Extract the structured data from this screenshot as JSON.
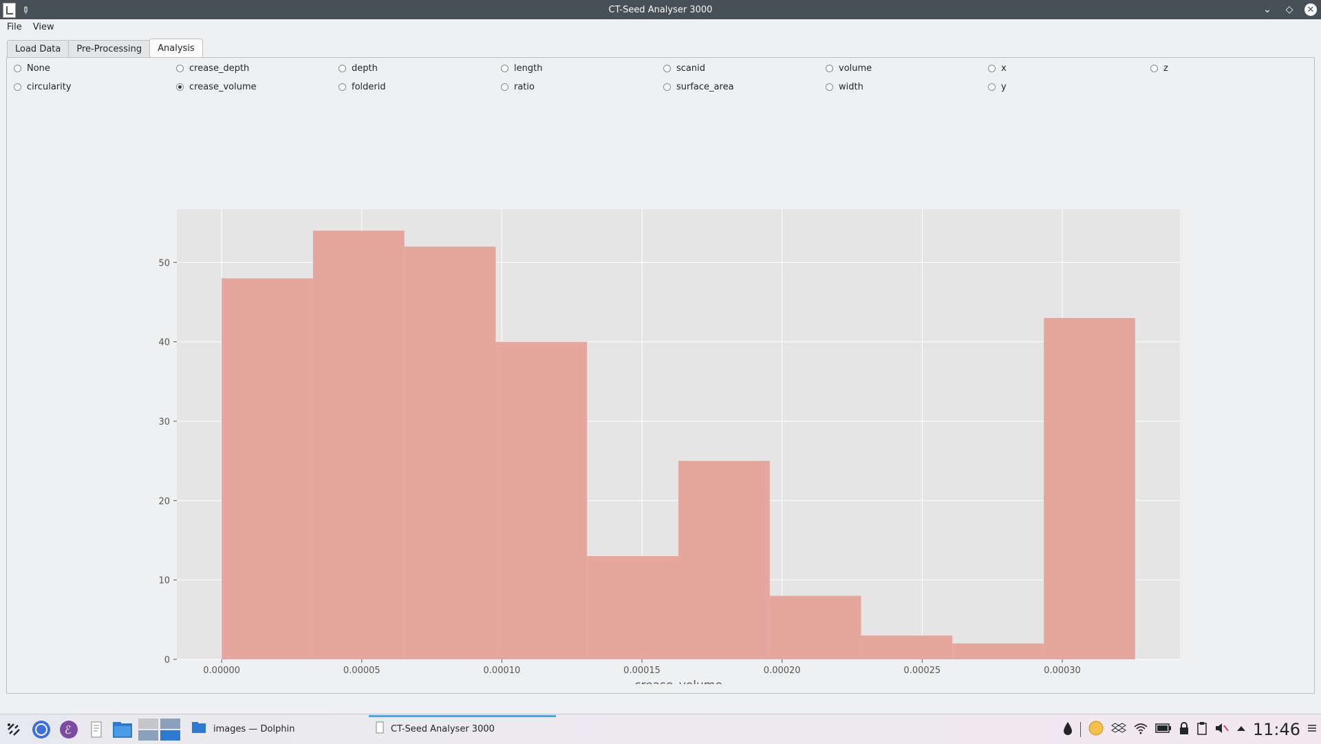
{
  "window": {
    "title": "CT-Seed Analyser 3000"
  },
  "menu": [
    "File",
    "View"
  ],
  "tabs": [
    {
      "label": "Load Data",
      "active": false
    },
    {
      "label": "Pre-Processing",
      "active": false
    },
    {
      "label": "Analysis",
      "active": true
    }
  ],
  "radio_options": [
    {
      "label": "None",
      "checked": false
    },
    {
      "label": "circularity",
      "checked": false
    },
    {
      "label": "crease_depth",
      "checked": false
    },
    {
      "label": "crease_volume",
      "checked": true
    },
    {
      "label": "depth",
      "checked": false
    },
    {
      "label": "folderid",
      "checked": false
    },
    {
      "label": "length",
      "checked": false
    },
    {
      "label": "ratio",
      "checked": false
    },
    {
      "label": "scanid",
      "checked": false
    },
    {
      "label": "surface_area",
      "checked": false
    },
    {
      "label": "volume",
      "checked": false
    },
    {
      "label": "width",
      "checked": false
    },
    {
      "label": "x",
      "checked": false
    },
    {
      "label": "y",
      "checked": false
    },
    {
      "label": "z",
      "checked": false
    }
  ],
  "chart_data": {
    "type": "bar",
    "xlabel": "crease_volume",
    "ylabel": "",
    "bin_width": 3.26e-05,
    "bins": [
      {
        "x0": 0.0,
        "count": 48
      },
      {
        "x0": 3.26e-05,
        "count": 54
      },
      {
        "x0": 6.52e-05,
        "count": 52
      },
      {
        "x0": 9.78e-05,
        "count": 40
      },
      {
        "x0": 0.0001304,
        "count": 13
      },
      {
        "x0": 0.000163,
        "count": 25
      },
      {
        "x0": 0.0001956,
        "count": 8
      },
      {
        "x0": 0.0002282,
        "count": 3
      },
      {
        "x0": 0.0002608,
        "count": 2
      },
      {
        "x0": 0.0002934,
        "count": 43
      }
    ],
    "xlim": [
      -1.6e-05,
      0.000342
    ],
    "ylim": [
      0,
      56.7
    ],
    "xticks": [
      "0.00000",
      "0.00005",
      "0.00010",
      "0.00015",
      "0.00020",
      "0.00025",
      "0.00030"
    ],
    "xtick_values": [
      0.0,
      5e-05,
      0.0001,
      0.00015,
      0.0002,
      0.00025,
      0.0003
    ],
    "yticks": [
      "0",
      "10",
      "20",
      "30",
      "40",
      "50"
    ],
    "ytick_values": [
      0,
      10,
      20,
      30,
      40,
      50
    ],
    "bar_color": "#e5a69d",
    "background_color": "#e5e5e5",
    "grid": true
  },
  "taskbar": {
    "tasks": [
      {
        "label": "images — Dolphin",
        "icon": "folder-icon"
      },
      {
        "label": "CT-Seed Analyser 3000",
        "icon": "app-icon",
        "active": true
      }
    ],
    "clock": "11:46"
  }
}
